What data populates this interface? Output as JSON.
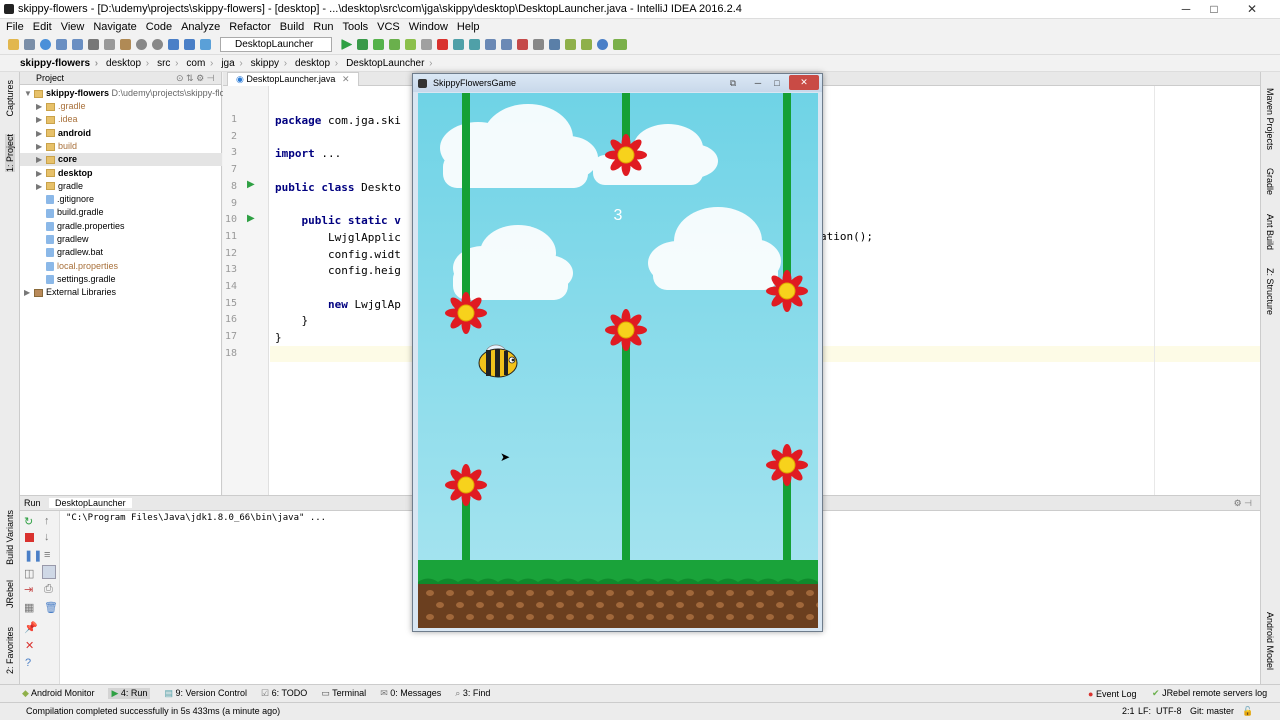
{
  "window": {
    "title": "skippy-flowers - [D:\\udemy\\projects\\skippy-flowers] - [desktop] - ...\\desktop\\src\\com\\jga\\skippy\\desktop\\DesktopLauncher.java - IntelliJ IDEA 2016.2.4"
  },
  "menu": [
    "File",
    "Edit",
    "View",
    "Navigate",
    "Code",
    "Analyze",
    "Refactor",
    "Build",
    "Run",
    "Tools",
    "VCS",
    "Window",
    "Help"
  ],
  "toolbar": {
    "run_config": "DesktopLauncher"
  },
  "breadcrumbs": [
    "skippy-flowers",
    "desktop",
    "src",
    "com",
    "jga",
    "skippy",
    "desktop",
    "DesktopLauncher"
  ],
  "project_panel": {
    "title": "Project",
    "root": {
      "name": "skippy-flowers",
      "path": "D:\\udemy\\projects\\skippy-flowe"
    },
    "items": [
      {
        "name": ".gradle",
        "type": "folder",
        "style": "excluded"
      },
      {
        "name": ".idea",
        "type": "folder",
        "style": "excluded"
      },
      {
        "name": "android",
        "type": "folder",
        "style": "bold"
      },
      {
        "name": "build",
        "type": "folder",
        "style": "excluded"
      },
      {
        "name": "core",
        "type": "folder",
        "style": "bold"
      },
      {
        "name": "desktop",
        "type": "folder",
        "style": "bold"
      },
      {
        "name": "gradle",
        "type": "folder",
        "style": "normal"
      },
      {
        "name": ".gitignore",
        "type": "file",
        "style": "normal"
      },
      {
        "name": "build.gradle",
        "type": "file",
        "style": "normal"
      },
      {
        "name": "gradle.properties",
        "type": "file",
        "style": "normal"
      },
      {
        "name": "gradlew",
        "type": "file",
        "style": "normal"
      },
      {
        "name": "gradlew.bat",
        "type": "file",
        "style": "normal"
      },
      {
        "name": "local.properties",
        "type": "file",
        "style": "excluded"
      },
      {
        "name": "settings.gradle",
        "type": "file",
        "style": "normal"
      },
      {
        "name": "External Libraries",
        "type": "lib",
        "style": "normal"
      }
    ]
  },
  "editor": {
    "tab": "DesktopLauncher.java",
    "lines": [
      {
        "n": "1",
        "kw": "package",
        "rest": " com.jga.ski"
      },
      {
        "n": "2",
        "kw": "",
        "rest": ""
      },
      {
        "n": "3",
        "kw": "import",
        "rest": " ..."
      },
      {
        "n": "7",
        "kw": "",
        "rest": ""
      },
      {
        "n": "8",
        "kw": "public class",
        "rest": " Deskto"
      },
      {
        "n": "9",
        "kw": "",
        "rest": ""
      },
      {
        "n": "10",
        "kw": "    public static v",
        "rest": ""
      },
      {
        "n": "11",
        "kw": "",
        "rest": "        LwjglApplic"
      },
      {
        "n": "12",
        "kw": "",
        "rest": "        config.widt"
      },
      {
        "n": "13",
        "kw": "",
        "rest": "        config.heig"
      },
      {
        "n": "14",
        "kw": "",
        "rest": ""
      },
      {
        "n": "15",
        "kw": "        new",
        "rest": " LwjglAp"
      },
      {
        "n": "16",
        "kw": "",
        "rest": "    }"
      },
      {
        "n": "17",
        "kw": "",
        "rest": "}"
      },
      {
        "n": "18",
        "kw": "",
        "rest": ""
      }
    ],
    "line11_tail": "ation();"
  },
  "run_panel": {
    "title": "Run",
    "config": "DesktopLauncher",
    "output": "\"C:\\Program Files\\Java\\jdk1.8.0_66\\bin\\java\" ..."
  },
  "side_tools": {
    "left": [
      "Captures",
      "1: Project",
      "Build Variants",
      "JRebel",
      "2: Favorites"
    ],
    "right": [
      "Maven Projects",
      "Gradle",
      "Ant Build",
      "Z: Structure",
      "Android Model"
    ]
  },
  "bottom_tools": [
    "Android Monitor",
    "4: Run",
    "9: Version Control",
    "6: TODO",
    "Terminal",
    "0: Messages",
    "3: Find"
  ],
  "bottom_tools_right": [
    "Event Log",
    "JRebel remote servers log"
  ],
  "status": {
    "message": "Compilation completed successfully in 5s 433ms (a minute ago)",
    "position": "2:1",
    "line_sep": "LF:",
    "encoding": "UTF-8",
    "git": "Git: master"
  },
  "game": {
    "title": "SkippyFlowersGame",
    "score": "3",
    "colors": {
      "sky": "#7fd6e8",
      "grass": "#1aa33a",
      "dirt": "#6b3f1f",
      "stem": "#15a035",
      "petal": "#e01b22",
      "center": "#f7d21c"
    }
  }
}
